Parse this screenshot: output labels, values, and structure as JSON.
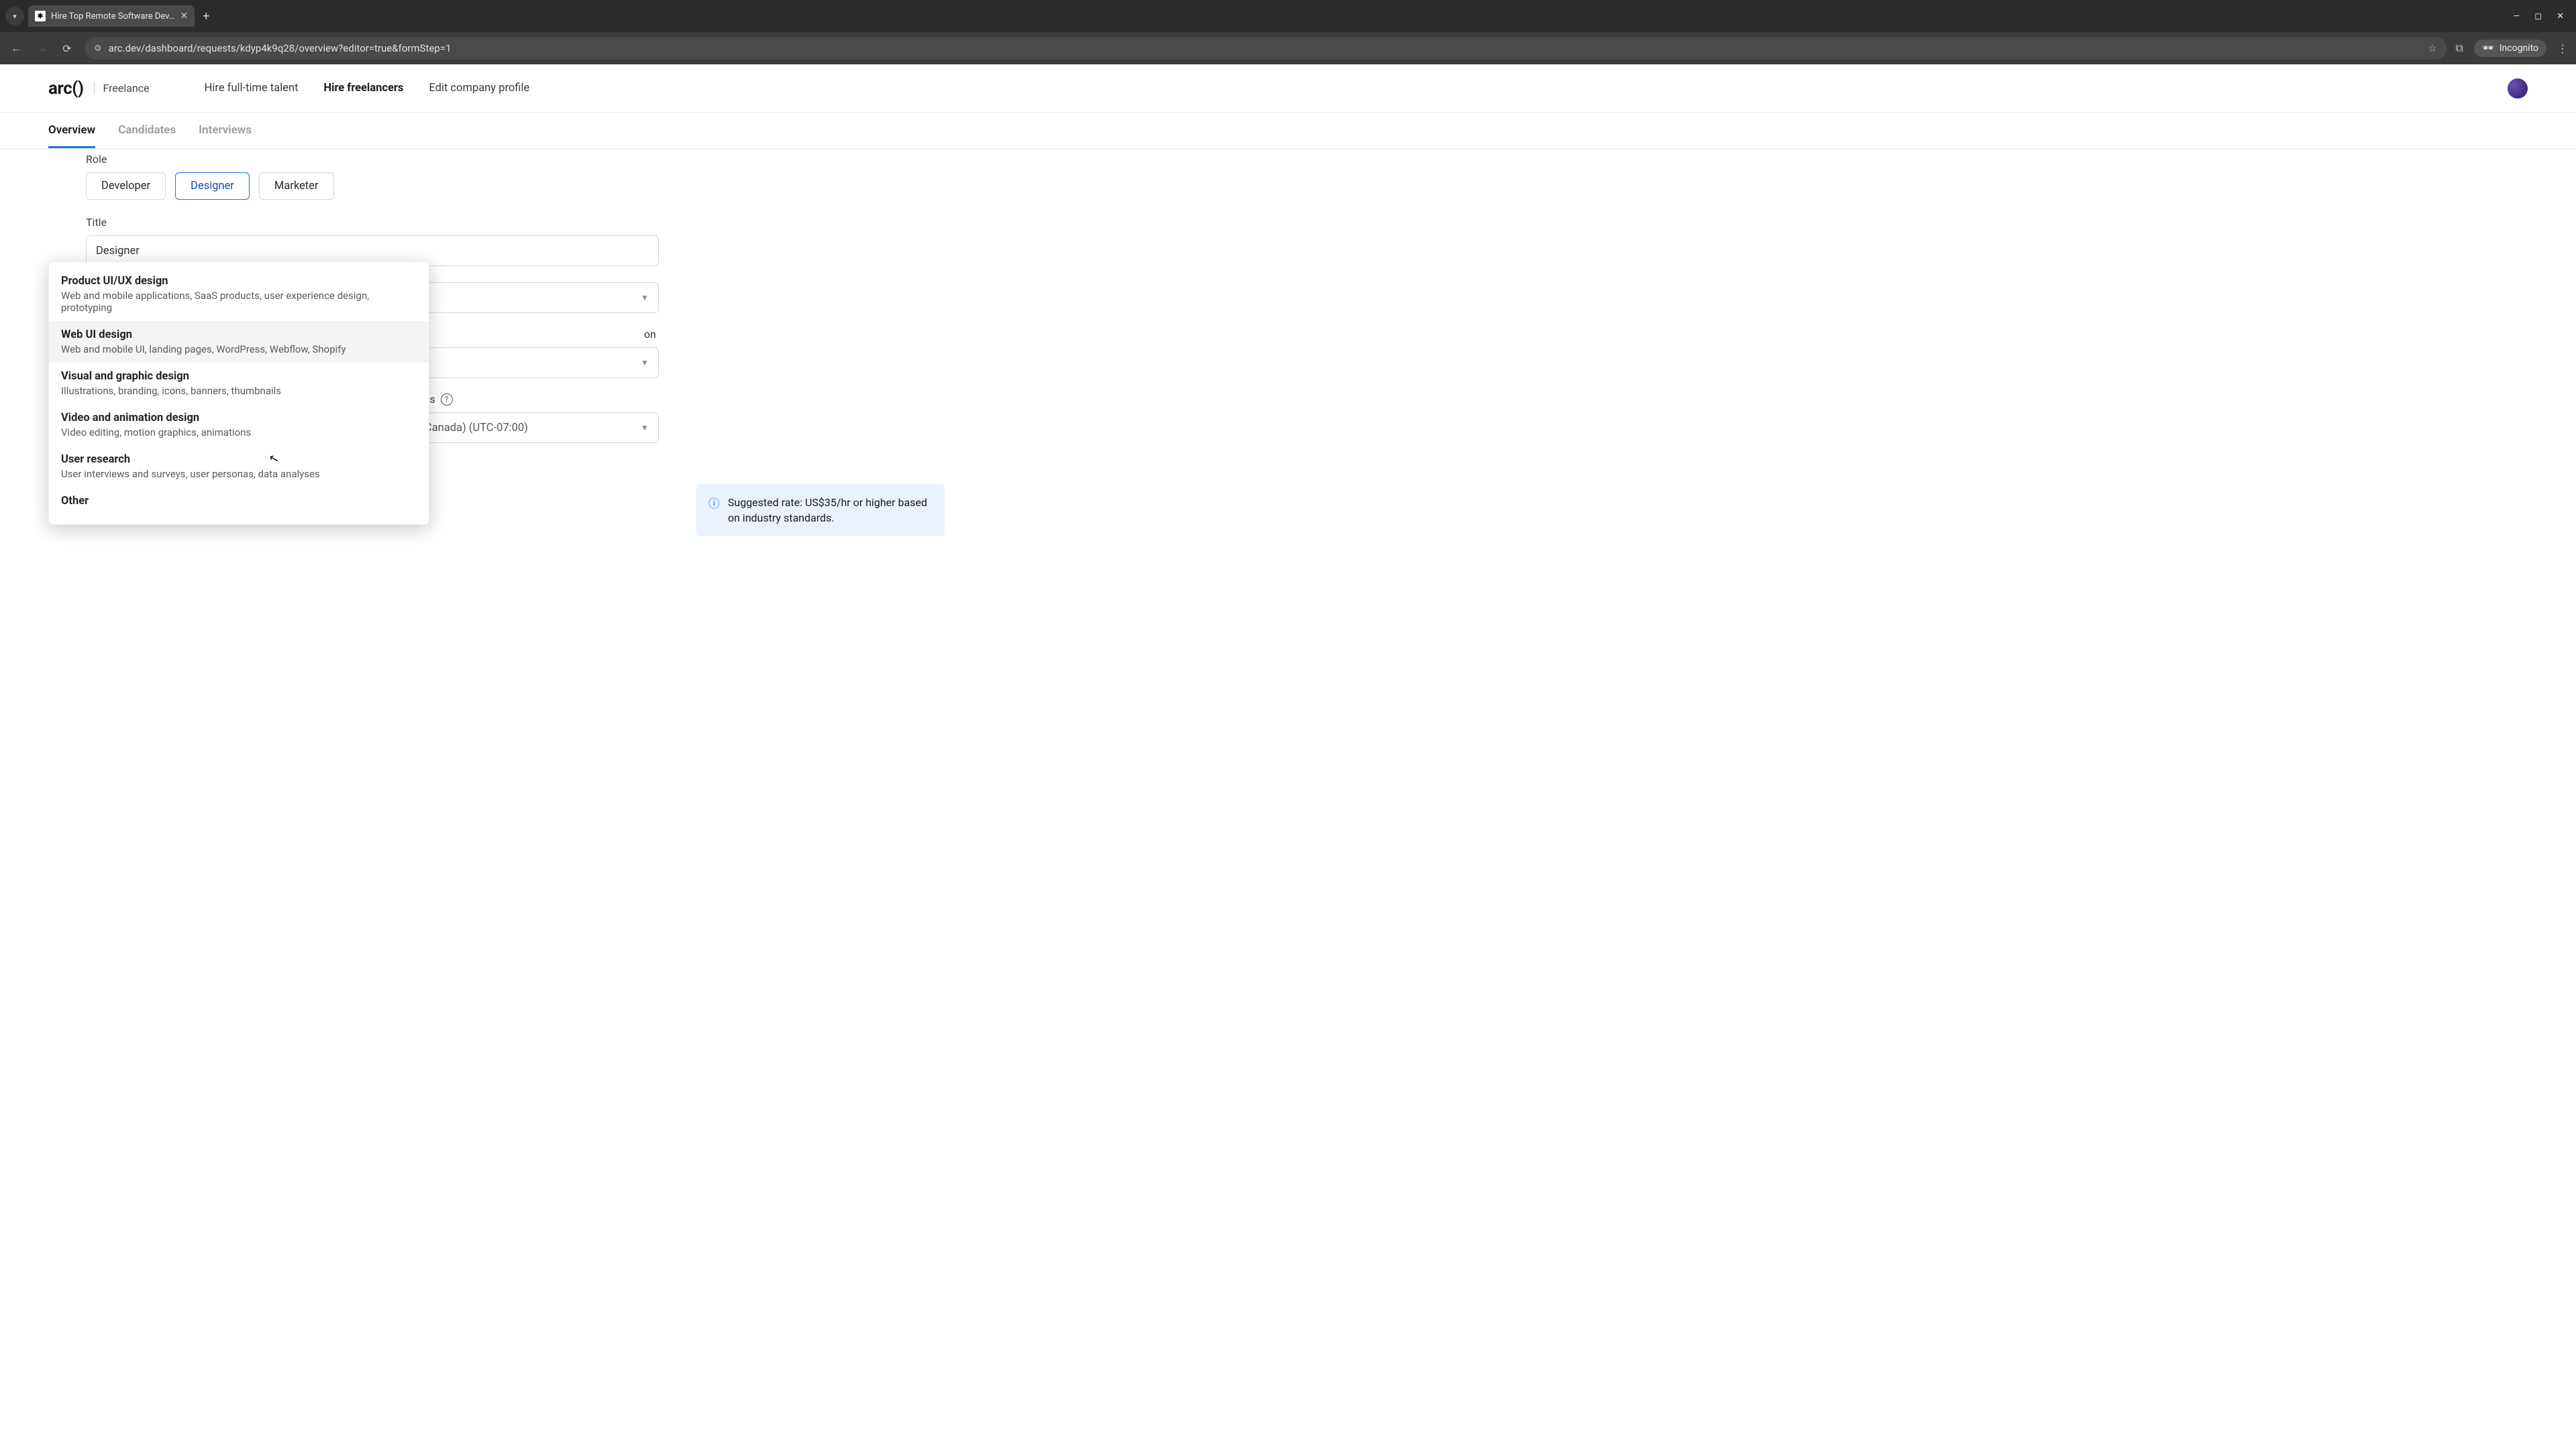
{
  "browser": {
    "tab_title": "Hire Top Remote Software Dev…",
    "url": "arc.dev/dashboard/requests/kdyp4k9q28/overview?editor=true&formStep=1",
    "incognito_label": "Incognito"
  },
  "header": {
    "logo": "arc()",
    "sub_brand": "Freelance",
    "nav": {
      "fulltime": "Hire full-time talent",
      "freelancers": "Hire freelancers",
      "edit_profile": "Edit company profile"
    }
  },
  "tabs": {
    "overview": "Overview",
    "candidates": "Candidates",
    "interviews": "Interviews"
  },
  "form": {
    "role_label": "Role",
    "roles": {
      "developer": "Developer",
      "designer": "Designer",
      "marketer": "Marketer"
    },
    "title_label": "Title",
    "title_value": "Designer",
    "hidden_row2_trail": "on",
    "tz_trail": "es",
    "tz_value": "Canada) (UTC-07:00)"
  },
  "dropdown": {
    "items": [
      {
        "title": "Product UI/UX design",
        "desc": "Web and mobile applications, SaaS products, user experience design, prototyping"
      },
      {
        "title": "Web UI design",
        "desc": "Web and mobile UI, landing pages, WordPress, Webflow, Shopify"
      },
      {
        "title": "Visual and graphic design",
        "desc": "Illustrations, branding, icons, banners, thumbnails"
      },
      {
        "title": "Video and animation design",
        "desc": "Video editing, motion graphics, animations"
      },
      {
        "title": "User research",
        "desc": "User interviews and surveys, user personas, data analyses"
      },
      {
        "title": "Other",
        "desc": ""
      }
    ]
  },
  "tip": {
    "text": "Suggested rate: US$35/hr or higher based on industry standards."
  }
}
